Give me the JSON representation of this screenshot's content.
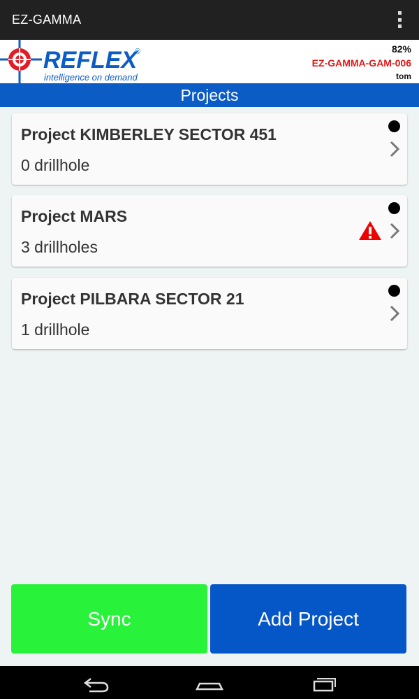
{
  "app": {
    "title": "EZ-GAMMA"
  },
  "brand": {
    "logo_text": "REFLEX",
    "logo_tagline": "intelligence on demand",
    "battery": "82%",
    "device": "EZ-GAMMA-GAM-006",
    "user": "tom"
  },
  "section": {
    "title": "Projects"
  },
  "projects": [
    {
      "name": "Project KIMBERLEY SECTOR 451",
      "count": "0 drillhole",
      "warning": false
    },
    {
      "name": "Project MARS",
      "count": "3 drillholes",
      "warning": true
    },
    {
      "name": "Project PILBARA SECTOR 21",
      "count": "1 drillhole",
      "warning": false
    }
  ],
  "buttons": {
    "sync": "Sync",
    "add_project": "Add Project"
  },
  "colors": {
    "action_bar": "#212121",
    "section_bar": "#0b5cc4",
    "sync_button": "#29f23a",
    "add_button": "#0556c7",
    "device_text": "#e01818",
    "warning": "#ee0000"
  },
  "icons": {
    "menu": "overflow-menu-icon",
    "status": "status-dot-icon",
    "chevron": "chevron-right-icon",
    "warning": "warning-icon",
    "nav_back": "back-icon",
    "nav_home": "home-icon",
    "nav_recents": "recents-icon"
  }
}
